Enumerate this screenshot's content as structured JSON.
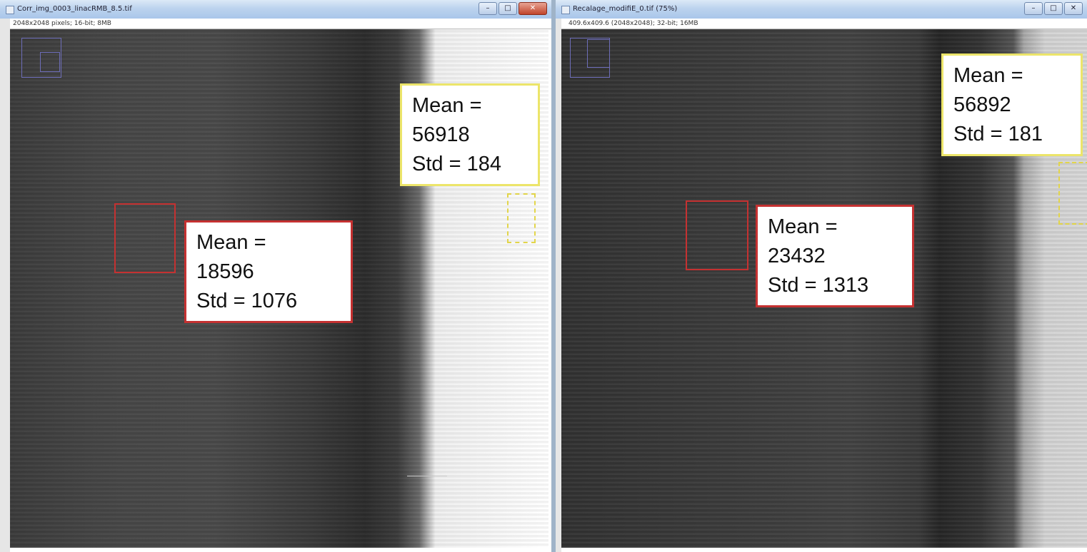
{
  "left_window": {
    "title": "Corr_img_0003_linacRMB_8.5.tif",
    "info": "2048x2048 pixels; 16-bit; 8MB",
    "roi_dark": {
      "mean_label": "Mean =",
      "mean_value": "18596",
      "std": "Std = 1076"
    },
    "roi_bright": {
      "mean_label": "Mean =",
      "mean_value": "56918",
      "std": "Std = 184"
    }
  },
  "right_window": {
    "title": "Recalage_modifiE_0.tif (75%)",
    "info": "409.6x409.6 (2048x2048); 32-bit; 16MB",
    "roi_dark": {
      "mean_label": "Mean =",
      "mean_value": "23432",
      "std": "Std = 1313"
    },
    "roi_bright": {
      "mean_label": "Mean =",
      "mean_value": "56892",
      "std": "Std = 181"
    }
  },
  "window_controls": {
    "minimize": "–",
    "maximize": "□",
    "close": "✕"
  },
  "colors": {
    "roi_dark": "#c53131",
    "roi_bright": "#e2d54a",
    "navigator": "#6d6db8"
  },
  "icons": [
    "app-icon",
    "minimize-icon",
    "maximize-icon",
    "close-icon"
  ]
}
